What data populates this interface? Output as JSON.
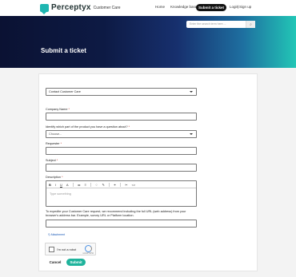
{
  "header": {
    "logo_text": "Perceptyx",
    "logo_sub": "Customer Care",
    "nav_home": "Home",
    "nav_kb": "Knowledge base",
    "nav_submit": "Submit a ticket",
    "nav_login": "Login",
    "nav_sep": "|",
    "nav_signup": "Sign up"
  },
  "hero": {
    "title": "Submit a ticket",
    "search_placeholder": "Enter the search term here....",
    "search_icon": "search-icon"
  },
  "form": {
    "ticket_form": "Contact Customer Care",
    "company_label": "Company Name",
    "product_label": "Identify which part of the product you have a question about?",
    "product_value": "Choose...",
    "requester_label": "Requester",
    "subject_label": "Subject",
    "description_label": "Description",
    "editor_placeholder": "Type something",
    "help_text": "To expedite your Customer Care request, we recommend including the full URL (web address) from your browser's address bar. Example, survey URL or Platform location.",
    "attachment": "Attachment",
    "required_mark": "*",
    "toolbar": [
      "B",
      "I",
      "U",
      "A",
      "≔",
      "≡",
      "♢",
      "✎",
      "⚭",
      "✂",
      "<>"
    ]
  },
  "captcha": {
    "label": "I'm not a robot",
    "brand": "reCAPTCHA"
  },
  "actions": {
    "cancel": "Cancel",
    "submit": "Submit"
  },
  "colors": {
    "accent": "#1fb39c",
    "brand": "#1fb6b1",
    "hero_dark": "#0b1233"
  }
}
